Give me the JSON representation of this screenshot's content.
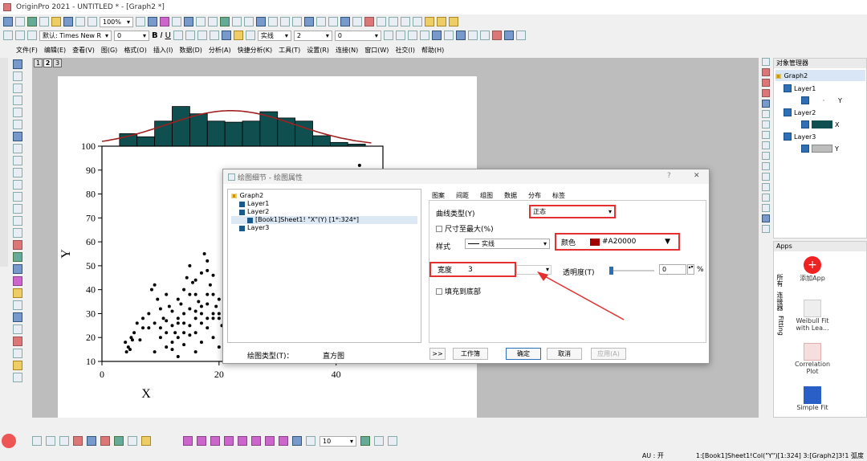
{
  "window": {
    "title": "OriginPro 2021 - UNTITLED * - [Graph2 *]"
  },
  "toolbar": {
    "zoom": "100%",
    "font": "默认: Times New R",
    "font_size": "0",
    "line_style": "实线",
    "line_width": "2",
    "val0": "0",
    "combo10": "10"
  },
  "menu": [
    "文件(F)",
    "编辑(E)",
    "查看(V)",
    "图(G)",
    "格式(O)",
    "插入(I)",
    "数据(D)",
    "分析(A)",
    "快捷分析(K)",
    "工具(T)",
    "设置(R)",
    "连接(N)",
    "窗口(W)",
    "社交(I)",
    "帮助(H)"
  ],
  "layer_tabs": [
    "1",
    "2",
    "3"
  ],
  "chart_data": {
    "type": "scatter",
    "xlabel": "X",
    "ylabel": "Y",
    "xlim": [
      0,
      48
    ],
    "ylim": [
      10,
      100
    ],
    "xticks": [
      "0",
      "20",
      "40"
    ],
    "yticks": [
      "10",
      "20",
      "30",
      "40",
      "50",
      "60",
      "70",
      "80",
      "90",
      "100"
    ],
    "marginal_histogram": {
      "type": "bar",
      "bar_color": "#0f4f4f",
      "curve_color": "#a02020",
      "bins": [
        [
          3,
          6,
          0.6
        ],
        [
          6,
          9,
          0.45
        ],
        [
          9,
          12,
          1.2
        ],
        [
          12,
          15,
          1.9
        ],
        [
          15,
          18,
          1.55
        ],
        [
          18,
          21,
          1.2
        ],
        [
          21,
          24,
          1.15
        ],
        [
          24,
          27,
          1.2
        ],
        [
          27,
          30,
          1.65
        ],
        [
          30,
          33,
          1.35
        ],
        [
          33,
          36,
          1.2
        ],
        [
          36,
          39,
          0.5
        ],
        [
          39,
          42,
          0.18
        ],
        [
          42,
          45,
          0.1
        ]
      ]
    },
    "points": [
      [
        4,
        18
      ],
      [
        4.5,
        16
      ],
      [
        5,
        20
      ],
      [
        4.2,
        14
      ],
      [
        5.5,
        22
      ],
      [
        6,
        26
      ],
      [
        4.8,
        15
      ],
      [
        5.2,
        19
      ],
      [
        6.5,
        19
      ],
      [
        7,
        24
      ],
      [
        8,
        30
      ],
      [
        8.5,
        40
      ],
      [
        9,
        42
      ],
      [
        9.5,
        36
      ],
      [
        10,
        32
      ],
      [
        10.5,
        28
      ],
      [
        11,
        38
      ],
      [
        11.5,
        33
      ],
      [
        12,
        25
      ],
      [
        12.5,
        22
      ],
      [
        13,
        28
      ],
      [
        13.5,
        34
      ],
      [
        14,
        40
      ],
      [
        14.5,
        45
      ],
      [
        15,
        50
      ],
      [
        15.5,
        43
      ],
      [
        16,
        38
      ],
      [
        16.5,
        35
      ],
      [
        17,
        30
      ],
      [
        17.5,
        55
      ],
      [
        18,
        48
      ],
      [
        18.5,
        42
      ],
      [
        19,
        38
      ],
      [
        19.5,
        33
      ],
      [
        20,
        28
      ],
      [
        20.5,
        25
      ],
      [
        21,
        45
      ],
      [
        21.5,
        41
      ],
      [
        22,
        37
      ],
      [
        22.5,
        32
      ],
      [
        23,
        60
      ],
      [
        23.5,
        70
      ],
      [
        24,
        55
      ],
      [
        24.5,
        50
      ],
      [
        12,
        15
      ],
      [
        13,
        12
      ],
      [
        14,
        17
      ],
      [
        15,
        21
      ],
      [
        16,
        14
      ],
      [
        17,
        18
      ],
      [
        18,
        24
      ],
      [
        19,
        20
      ],
      [
        20,
        16
      ],
      [
        21,
        22
      ],
      [
        22,
        18
      ],
      [
        10,
        20
      ],
      [
        11,
        16
      ],
      [
        9,
        14
      ],
      [
        8,
        24
      ],
      [
        7,
        28
      ],
      [
        14,
        30
      ],
      [
        15,
        32
      ],
      [
        16,
        28
      ],
      [
        17,
        26
      ],
      [
        18,
        34
      ],
      [
        19,
        30
      ],
      [
        20,
        36
      ],
      [
        21,
        38
      ],
      [
        22,
        44
      ],
      [
        23,
        40
      ],
      [
        13,
        36
      ],
      [
        12,
        31
      ],
      [
        11,
        27
      ],
      [
        10,
        24
      ],
      [
        9,
        26
      ],
      [
        16,
        44
      ],
      [
        17,
        47
      ],
      [
        18,
        52
      ],
      [
        19,
        46
      ],
      [
        15,
        38
      ],
      [
        14,
        26
      ],
      [
        13,
        20
      ],
      [
        12,
        18
      ],
      [
        11,
        22
      ],
      [
        20,
        30
      ],
      [
        22,
        26
      ],
      [
        23,
        30
      ],
      [
        24,
        34
      ],
      [
        21,
        28
      ],
      [
        16,
        22
      ],
      [
        15,
        25
      ],
      [
        14,
        22
      ],
      [
        13,
        26
      ],
      [
        18,
        38
      ],
      [
        19,
        28
      ],
      [
        17,
        33
      ],
      [
        16,
        31
      ],
      [
        18,
        28
      ],
      [
        44,
        92
      ]
    ]
  },
  "dialog": {
    "title": "绘图细节 - 绘图属性",
    "tree": [
      "Graph2",
      "Layer1",
      "Layer2",
      "[Book1]Sheet1! \"X\"(Y) [1*:324*]",
      "Layer3"
    ],
    "tabs": [
      "图案",
      "间距",
      "组图",
      "数据",
      "分布",
      "标签"
    ],
    "active_tab": "分布",
    "curve_type_label": "曲线类型(Y)",
    "curve_type_value": "正态",
    "max_size_label": "尺寸至最大(%)",
    "style_label": "样式",
    "style_value": "实线",
    "color_label": "颜色",
    "color_value": "#A20000",
    "color_swatch": "#a20000",
    "width_label": "宽度",
    "width_value": "3",
    "transparency_label": "透明度(T)",
    "transparency_value": "0",
    "transparency_unit": "%",
    "fill_label": "填充到底部",
    "plot_type_label": "绘图类型(T)：",
    "plot_type_value": "直方图",
    "btn_expand": ">>",
    "btn_worksheet": "工作簿",
    "btn_ok": "确定",
    "btn_cancel": "取消",
    "btn_apply": "应用(A)",
    "help": "?",
    "close": "✕"
  },
  "object_manager": {
    "title": "对象管理器",
    "items": [
      {
        "label": "Graph2"
      },
      {
        "label": "Layer1"
      },
      {
        "label": "Y",
        "color": "#000000"
      },
      {
        "label": "Layer2"
      },
      {
        "label": "X",
        "color": "#0f4f4f"
      },
      {
        "label": "Layer3"
      },
      {
        "label": "Y",
        "color": "#bdbdbd"
      }
    ]
  },
  "apps": {
    "title": "Apps",
    "items": [
      "添加App",
      "Weibull Fit with Lea...",
      "Correlation Plot",
      "Simple Fit"
    ],
    "side_tabs": [
      "所有",
      "连接器",
      "Fitting"
    ]
  },
  "status": {
    "au": "AU : 开",
    "info": "1:[Book1]Sheet1!Col(\"Y\")[1:324] 3:[Graph2]3!1 弧度"
  }
}
